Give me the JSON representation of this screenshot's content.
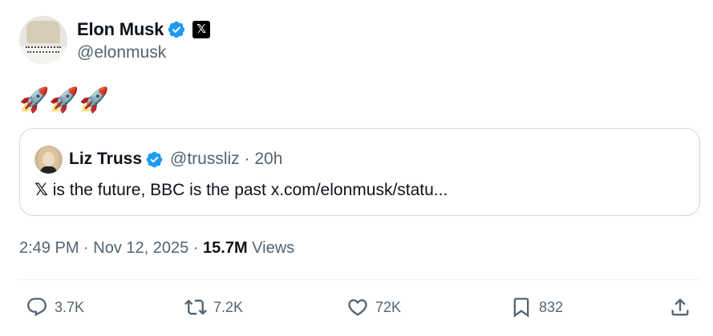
{
  "author": {
    "display_name": "Elon Musk",
    "handle": "@elonmusk",
    "verified_icon": "verified-badge-icon",
    "affiliate_badge": "x-logo-icon",
    "affiliate_badge_text": "𝕏"
  },
  "post": {
    "emoji": "🚀🚀🚀",
    "emoji_icon": "rocket-icon"
  },
  "quote": {
    "display_name": "Liz Truss",
    "handle": "@trussliz",
    "separator": "·",
    "age": "20h",
    "text_prefix": "𝕏",
    "text": " is the future, BBC is the past x.com/elonmusk/statu..."
  },
  "meta": {
    "time": "2:49 PM",
    "sep1": " · ",
    "date": "Nov 12, 2025",
    "sep2": " · ",
    "views_count": "15.7M",
    "views_label": " Views"
  },
  "actions": {
    "replies": "3.7K",
    "reposts": "7.2K",
    "likes": "72K",
    "bookmarks": "832"
  },
  "colors": {
    "verified": "#1d9bf0",
    "text": "#0f1419",
    "secondary": "#536471",
    "border": "#cfd9de"
  }
}
